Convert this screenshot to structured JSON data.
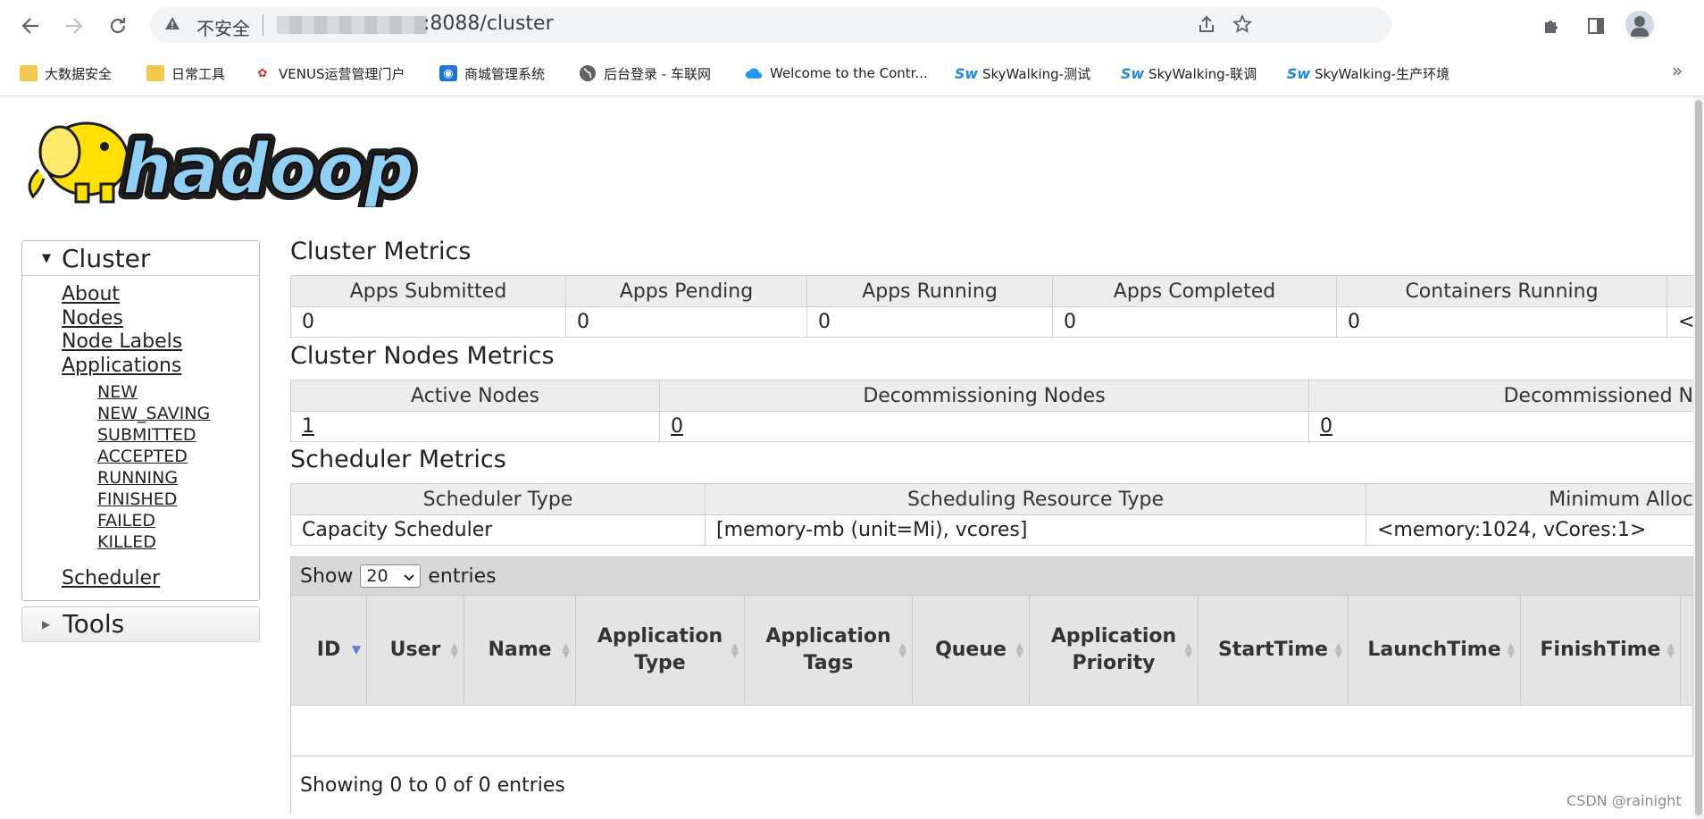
{
  "browser": {
    "security_label": "不安全",
    "url": ":8088/cluster",
    "bookmarks": [
      {
        "label": "大数据安全",
        "icon": "folder-icon"
      },
      {
        "label": "日常工具",
        "icon": "folder-icon"
      },
      {
        "label": "VENUS运营管理门户",
        "icon": "unicom-icon"
      },
      {
        "label": "商城管理系统",
        "icon": "shop-icon"
      },
      {
        "label": "后台登录 - 车联网",
        "icon": "globe-icon"
      },
      {
        "label": "Welcome to the Contr...",
        "icon": "cloud-icon"
      },
      {
        "label": "SkyWalking-测试",
        "icon": "sw-icon"
      },
      {
        "label": "SkyWalking-联调",
        "icon": "sw-icon"
      },
      {
        "label": "SkyWalking-生产环境",
        "icon": "sw-icon"
      }
    ],
    "bookmarks_more": "»"
  },
  "logo": {
    "text": "hadoop"
  },
  "sidebar": {
    "cluster_label": "Cluster",
    "links": {
      "about": "About",
      "nodes": "Nodes",
      "node_labels": "Node Labels",
      "applications": "Applications",
      "scheduler": "Scheduler"
    },
    "app_states": [
      "NEW",
      "NEW_SAVING",
      "SUBMITTED",
      "ACCEPTED",
      "RUNNING",
      "FINISHED",
      "FAILED",
      "KILLED"
    ],
    "tools_label": "Tools"
  },
  "cluster_metrics": {
    "title": "Cluster Metrics",
    "headers": [
      "Apps Submitted",
      "Apps Pending",
      "Apps Running",
      "Apps Completed",
      "Containers Running"
    ],
    "values": [
      "0",
      "0",
      "0",
      "0",
      "0",
      "<"
    ]
  },
  "nodes_metrics": {
    "title": "Cluster Nodes Metrics",
    "headers": [
      "Active Nodes",
      "Decommissioning Nodes",
      "Decommissioned N"
    ],
    "values": [
      "1",
      "0",
      "0"
    ]
  },
  "scheduler_metrics": {
    "title": "Scheduler Metrics",
    "headers": [
      "Scheduler Type",
      "Scheduling Resource Type",
      "Minimum Alloc"
    ],
    "values": [
      "Capacity Scheduler",
      "[memory-mb (unit=Mi), vcores]",
      "<memory:1024, vCores:1>"
    ]
  },
  "apps_table": {
    "show_label": "Show",
    "entries_label": "entries",
    "page_size": "20",
    "columns": [
      "ID",
      "User",
      "Name",
      "Application Type",
      "Application Tags",
      "Queue",
      "Application Priority",
      "StartTime",
      "LaunchTime",
      "FinishTime"
    ],
    "info": "Showing 0 to 0 of 0 entries"
  },
  "watermark": "CSDN @rainight"
}
